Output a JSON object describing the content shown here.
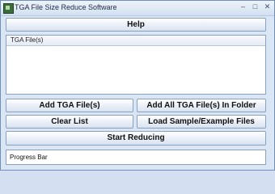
{
  "window": {
    "title": "TGA File Size Reduce Software",
    "controls": {
      "minimize": "–",
      "maximize": "□",
      "close": "✕"
    }
  },
  "buttons": {
    "help": "Help",
    "add_files": "Add TGA File(s)",
    "add_folder": "Add All TGA File(s) In Folder",
    "clear_list": "Clear List",
    "load_samples": "Load Sample/Example Files",
    "start": "Start Reducing"
  },
  "list": {
    "header": "TGA File(s)",
    "items": []
  },
  "progress": {
    "label": "Progress Bar",
    "value": 0
  },
  "colors": {
    "background": "#dbe6f5",
    "border": "#8aa0bf"
  }
}
